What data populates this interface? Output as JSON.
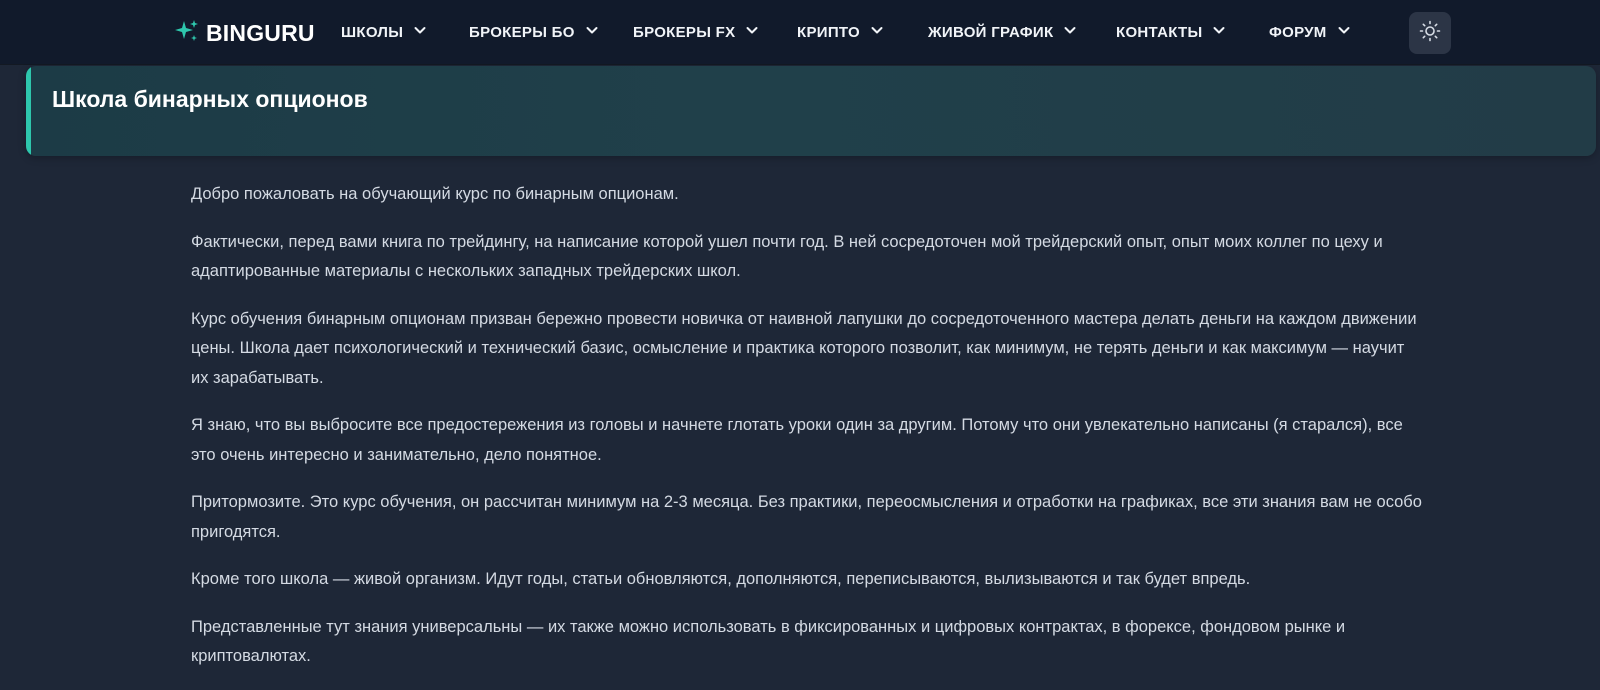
{
  "header": {
    "logo_text": "BINGURU",
    "nav": [
      {
        "label": "ШКОЛЫ"
      },
      {
        "label": "БРОКЕРЫ БО"
      },
      {
        "label": "БРОКЕРЫ FX"
      },
      {
        "label": "КРИПТО"
      },
      {
        "label": "ЖИВОЙ ГРАФИК"
      },
      {
        "label": "КОНТАКТЫ"
      },
      {
        "label": "ФОРУМ"
      }
    ],
    "theme_icon": "sun-icon"
  },
  "banner": {
    "title": "Школа бинарных опционов"
  },
  "article": {
    "paragraphs": [
      "Добро пожаловать на обучающий курс по бинарным опционам.",
      "Фактически, перед вами книга по трейдингу, на написание которой ушел почти год. В ней сосредоточен мой трейдерский опыт, опыт моих коллег по цеху и адаптированные материалы с нескольких западных трейдерских школ.",
      "Курс обучения бинарным опционам призван бережно провести новичка от наивной лапушки до сосредоточенного мастера делать деньги на каждом движении цены. Школа дает психологический и технический базис, осмысление и практика которого позволит, как минимум, не терять деньги и как максимум — научит их зарабатывать.",
      "Я знаю, что вы выбросите все предостережения из головы и начнете глотать уроки один за другим. Потому что они увлекательно написаны (я старался), все это очень интересно и занимательно, дело понятное.",
      "Притормозите. Это курс обучения, он рассчитан минимум на 2-3 месяца. Без практики, переосмысления и отработки на графиках, все эти знания вам не особо пригодятся.",
      "Кроме того школа — живой организм. Идут годы, статьи обновляются, дополняются, переписываются, вылизываются и так будет впредь.",
      "Представленные тут знания универсальны — их также можно использовать в фиксированных и цифровых контрактах, в форексе, фондовом рынке и криптовалютах."
    ]
  },
  "colors": {
    "header_bg": "#111a2b",
    "page_bg": "#1e2737",
    "accent": "#2ec7ad"
  }
}
